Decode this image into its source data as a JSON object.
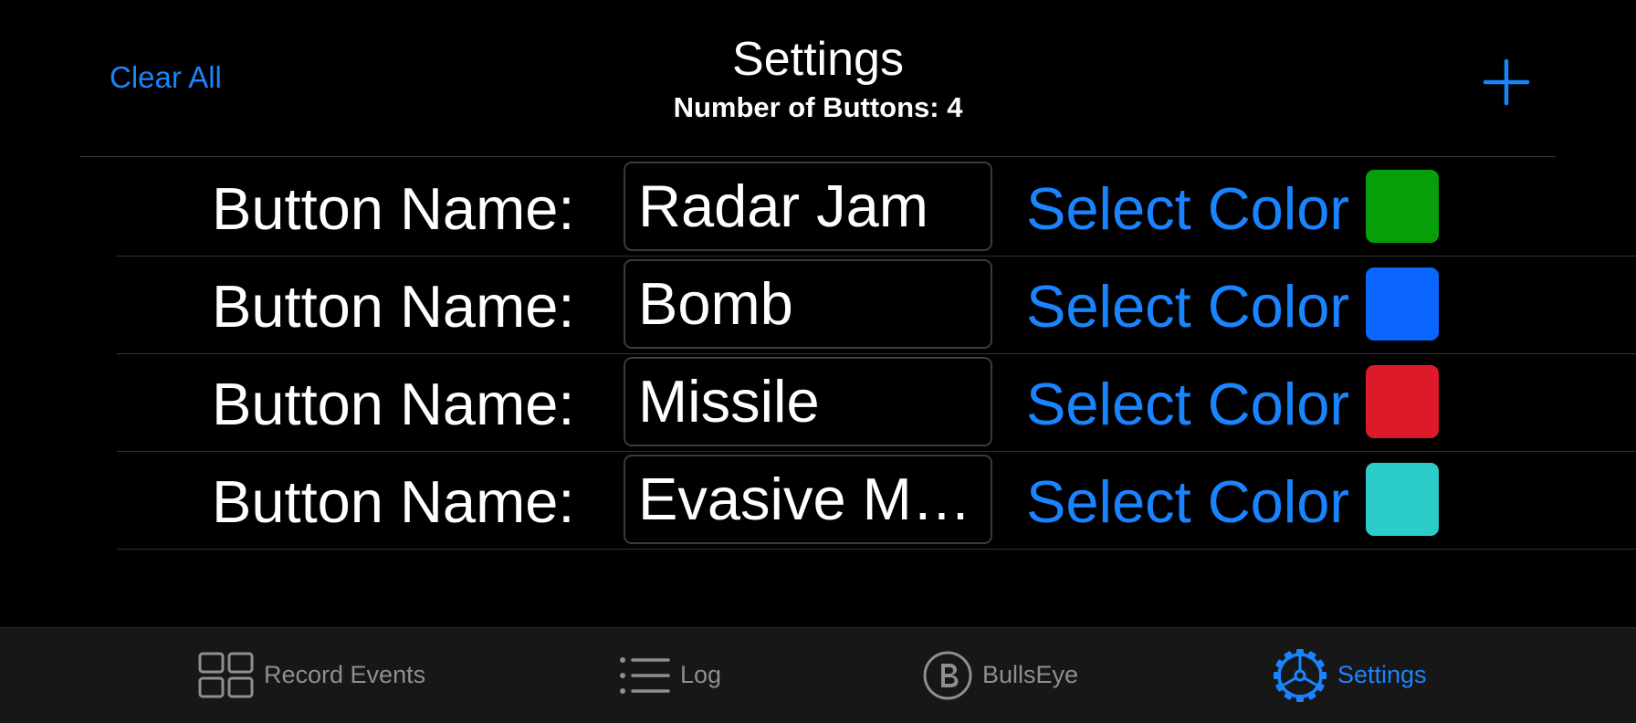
{
  "navbar": {
    "clear_all": "Clear All",
    "title": "Settings",
    "subtitle": "Number of Buttons: 4",
    "add_icon": "plus-icon"
  },
  "rows": [
    {
      "label": "Button Name:",
      "value": "Radar Jam",
      "select_color": "Select Color",
      "color": "#079e0a"
    },
    {
      "label": "Button Name:",
      "value": "Bomb",
      "select_color": "Select Color",
      "color": "#0a66ff"
    },
    {
      "label": "Button Name:",
      "value": "Missile",
      "select_color": "Select Color",
      "color": "#dd1a2a"
    },
    {
      "label": "Button Name:",
      "value": "Evasive Ma...",
      "select_color": "Select Color",
      "color": "#2ccdc8"
    }
  ],
  "tabbar": {
    "tabs": [
      {
        "label": "Record Events",
        "icon": "grid-icon",
        "active": false
      },
      {
        "label": "Log",
        "icon": "list-icon",
        "active": false
      },
      {
        "label": "BullsEye",
        "icon": "circle-b-icon",
        "active": false
      },
      {
        "label": "Settings",
        "icon": "gear-icon",
        "active": true
      }
    ]
  },
  "colors": {
    "accent": "#1a84ff",
    "inactive": "#8e8e93",
    "background": "#000000",
    "tabbar_background": "#171717"
  }
}
